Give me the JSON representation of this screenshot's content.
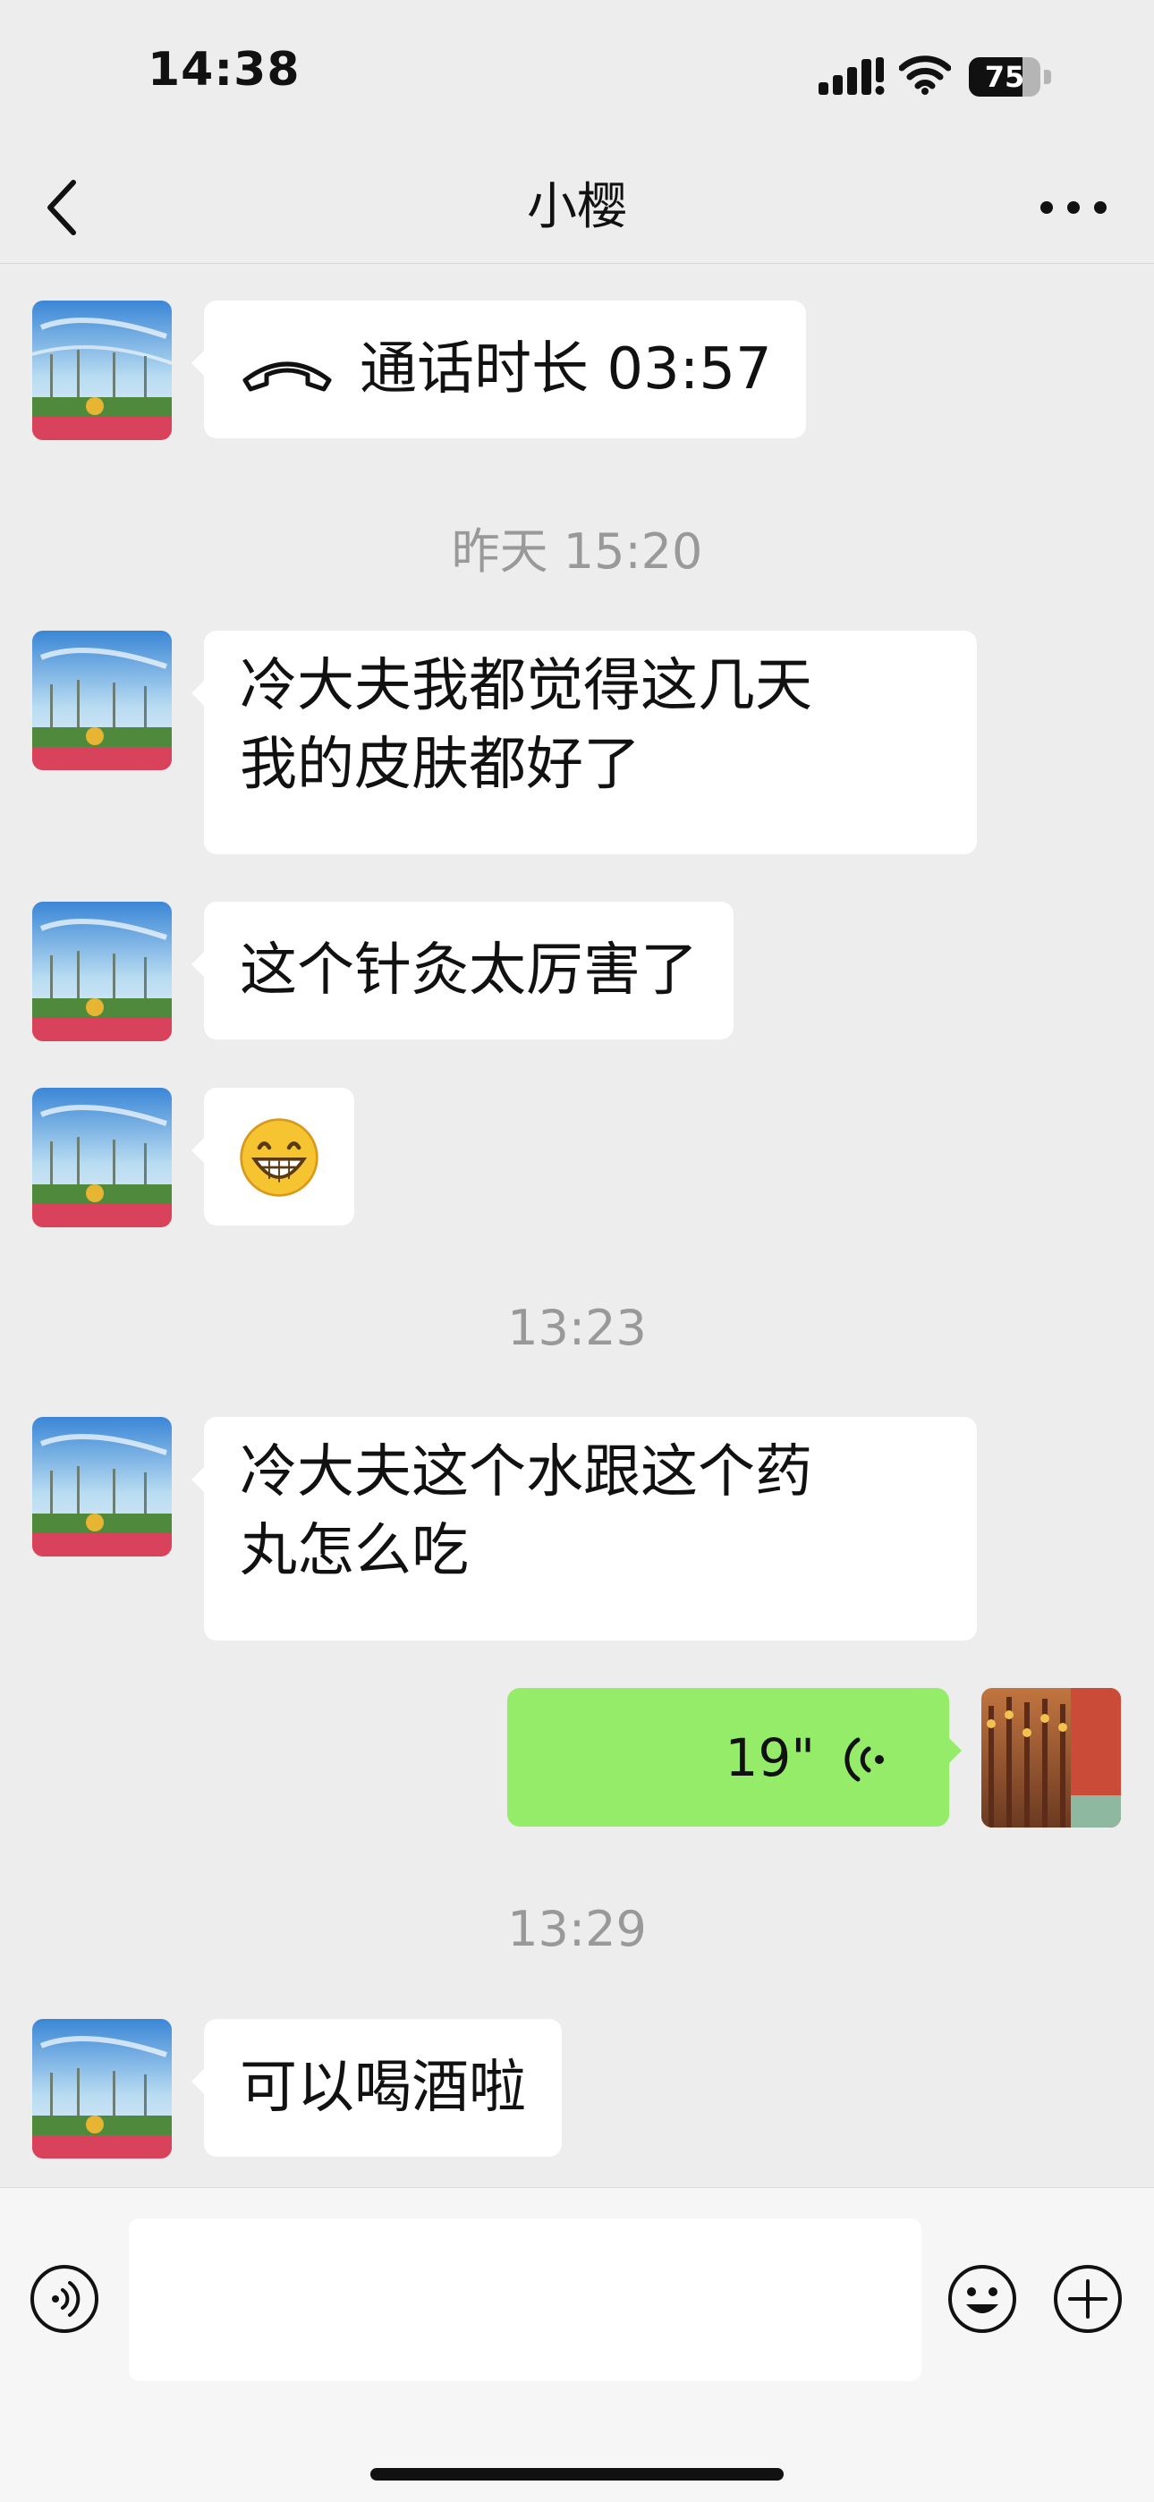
{
  "status_bar": {
    "time": "14:38",
    "battery_level": "75",
    "battery_fraction": 0.75
  },
  "nav": {
    "title": "小樱"
  },
  "messages": {
    "call": {
      "icon": "phone-hangup-icon",
      "label": "通话时长 03:57"
    },
    "ts1": "昨天 15:20",
    "m1": {
      "line1": "冷大夫我都觉得这几天",
      "line2": "我的皮肤都好了"
    },
    "m2": "这个针灸太厉害了",
    "m3": {
      "emoji": "grinning-face-emoji"
    },
    "ts2": "13:23",
    "m4": {
      "line1": "冷大夫这个水跟这个药",
      "line2": "丸怎么吃"
    },
    "voice": {
      "duration": "19\"",
      "icon": "voice-wave-icon"
    },
    "ts3": "13:29",
    "m5": "可以喝酒啦"
  },
  "input_bar": {
    "voice_icon": "voice-input-icon",
    "emoji_icon": "emoji-icon",
    "plus_icon": "plus-icon",
    "text_value": ""
  },
  "colors": {
    "background": "#ededed",
    "my_bubble": "#95ec69",
    "other_bubble": "#ffffff",
    "timestamp": "#999999"
  }
}
